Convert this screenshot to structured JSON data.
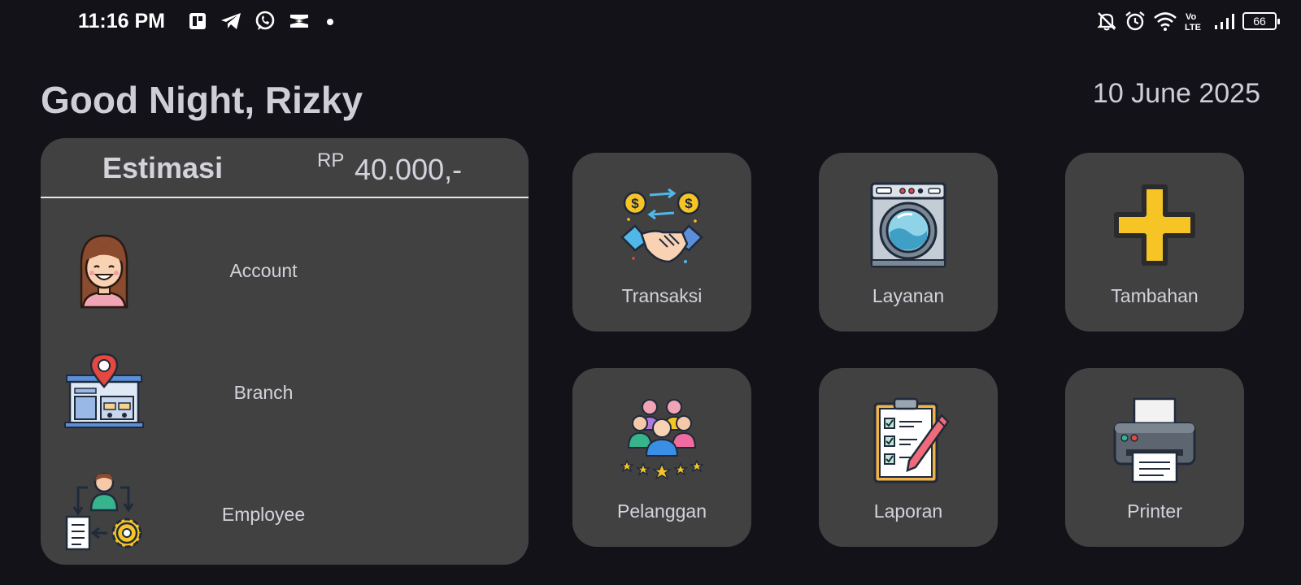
{
  "status_bar": {
    "time": "11:16 PM",
    "battery": "66",
    "left_icons": [
      "notification-app-icon",
      "telegram-icon",
      "whatsapp-icon",
      "capcut-icon",
      "dot-icon"
    ],
    "right_icons": [
      "bell-off-icon",
      "alarm-icon",
      "wifi-icon",
      "volte-icon",
      "signal-icon",
      "battery-icon"
    ]
  },
  "header": {
    "greeting": "Good Night, Rizky",
    "date": "10 June 2025"
  },
  "estimate_card": {
    "label": "Estimasi",
    "currency": "RP",
    "amount": "40.000,-",
    "items": [
      {
        "label": "Account",
        "icon": "account-avatar-icon"
      },
      {
        "label": "Branch",
        "icon": "branch-store-icon"
      },
      {
        "label": "Employee",
        "icon": "employee-management-icon"
      }
    ]
  },
  "tiles": [
    {
      "label": "Transaksi",
      "icon": "handshake-money-icon"
    },
    {
      "label": "Layanan",
      "icon": "washing-machine-icon"
    },
    {
      "label": "Tambahan",
      "icon": "plus-icon"
    },
    {
      "label": "Pelanggan",
      "icon": "customers-group-icon"
    },
    {
      "label": "Laporan",
      "icon": "report-clipboard-icon"
    },
    {
      "label": "Printer",
      "icon": "printer-icon"
    }
  ],
  "colors": {
    "background": "#131218",
    "card": "#424142",
    "text": "#d4d2da",
    "accent_yellow": "#f7c426"
  }
}
